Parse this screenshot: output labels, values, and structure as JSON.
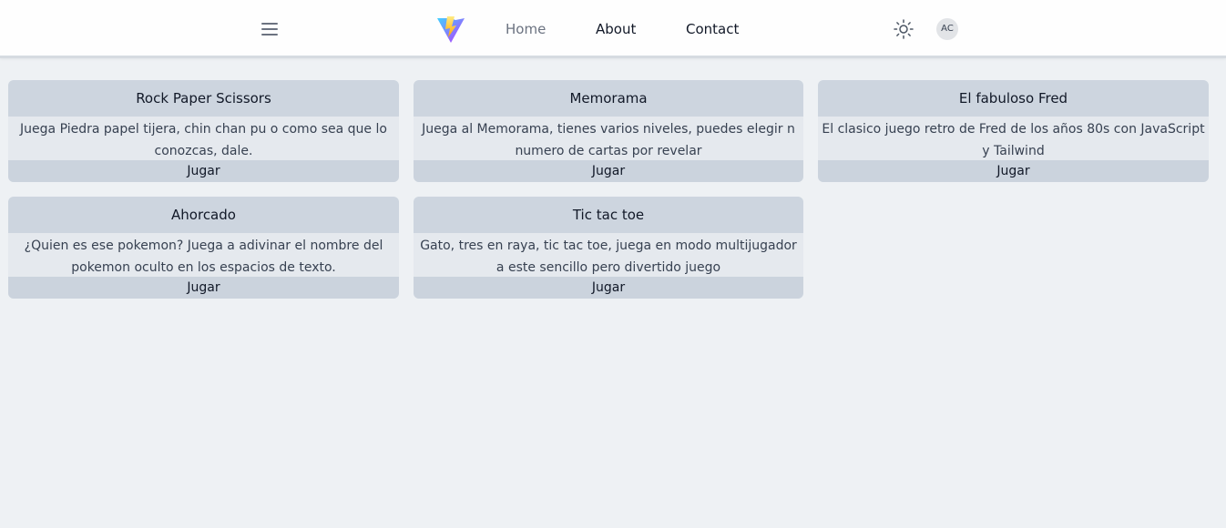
{
  "nav": {
    "links": [
      "Home",
      "About",
      "Contact"
    ],
    "avatar_initials": "AC",
    "icons": {
      "menu": "hamburger-menu-icon",
      "logo": "vite-logo",
      "theme": "sun-icon"
    }
  },
  "colors": {
    "card_header": "#cdd5df",
    "card_body": "#e5e9ee",
    "page_bg": "#eef1f4"
  },
  "cards": [
    {
      "title": "Rock Paper Scissors",
      "description": "Juega Piedra papel tijera, chin chan pu o como sea que lo conozcas, dale.",
      "button": "Jugar"
    },
    {
      "title": "Memorama",
      "description": "Juega al Memorama, tienes varios niveles, puedes elegir n numero de cartas por revelar",
      "button": "Jugar"
    },
    {
      "title": "El fabuloso Fred",
      "description": "El clasico juego retro de Fred de los años 80s con JavaScript y Tailwind",
      "button": "Jugar"
    },
    {
      "title": "Ahorcado",
      "description": "¿Quien es ese pokemon? Juega a adivinar el nombre del pokemon oculto en los espacios de texto.",
      "button": "Jugar"
    },
    {
      "title": "Tic tac toe",
      "description": "Gato, tres en raya, tic tac toe, juega en modo multijugador a este sencillo pero divertido juego",
      "button": "Jugar"
    }
  ]
}
